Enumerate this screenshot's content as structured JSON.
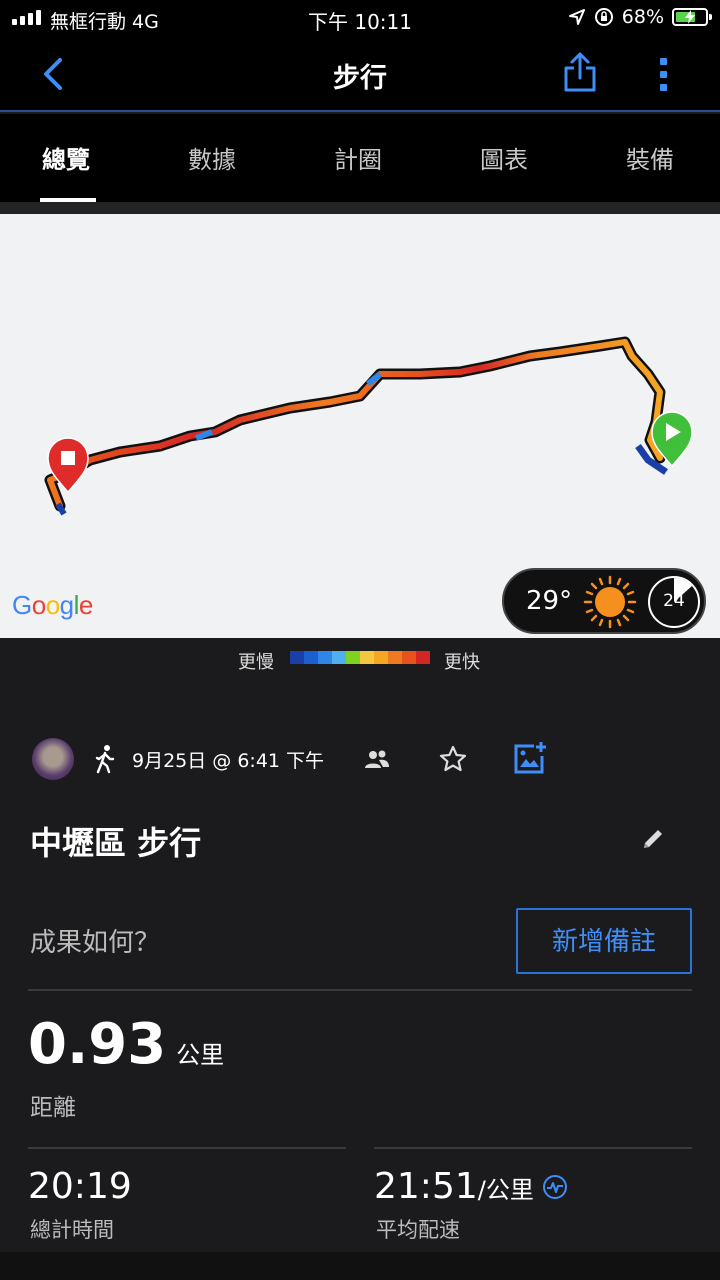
{
  "status_bar": {
    "carrier": "無框行動  4G",
    "time": "下午 10:11",
    "battery": "68%",
    "battery_level": 0.68
  },
  "nav": {
    "title": "步行",
    "back_icon": "chevron-left-icon",
    "share_icon": "share-icon",
    "more_icon": "more-vertical-icon"
  },
  "tabs": [
    {
      "label": "總覽",
      "active": true
    },
    {
      "label": "數據",
      "active": false
    },
    {
      "label": "計圈",
      "active": false
    },
    {
      "label": "圖表",
      "active": false
    },
    {
      "label": "裝備",
      "active": false
    }
  ],
  "map": {
    "attribution": "Google",
    "weather_temp": "29°",
    "weather_icon": "sun-icon",
    "hr_zone": "24"
  },
  "legend": {
    "slow": "更慢",
    "fast": "更快",
    "colors": [
      "#1a3fa8",
      "#1d5fd0",
      "#2f86e6",
      "#4fb0f0",
      "#7ed321",
      "#f5c640",
      "#f5a623",
      "#f07a20",
      "#e8521c",
      "#d42525"
    ]
  },
  "activity": {
    "date": "9月25日 @ 6:41 下午",
    "title": "中壢區 步行",
    "prompt": "成果如何？",
    "add_note": "新增備註"
  },
  "stats": {
    "distance": {
      "value": "0.93",
      "unit": "公里",
      "label": "距離"
    },
    "total_time": {
      "value": "20:19",
      "label": "總計時間"
    },
    "avg_pace": {
      "value": "21:51",
      "unit": "/公里",
      "label": "平均配速"
    }
  },
  "colors": {
    "accent": "#2a73d9",
    "background": "#1b1b1d"
  }
}
